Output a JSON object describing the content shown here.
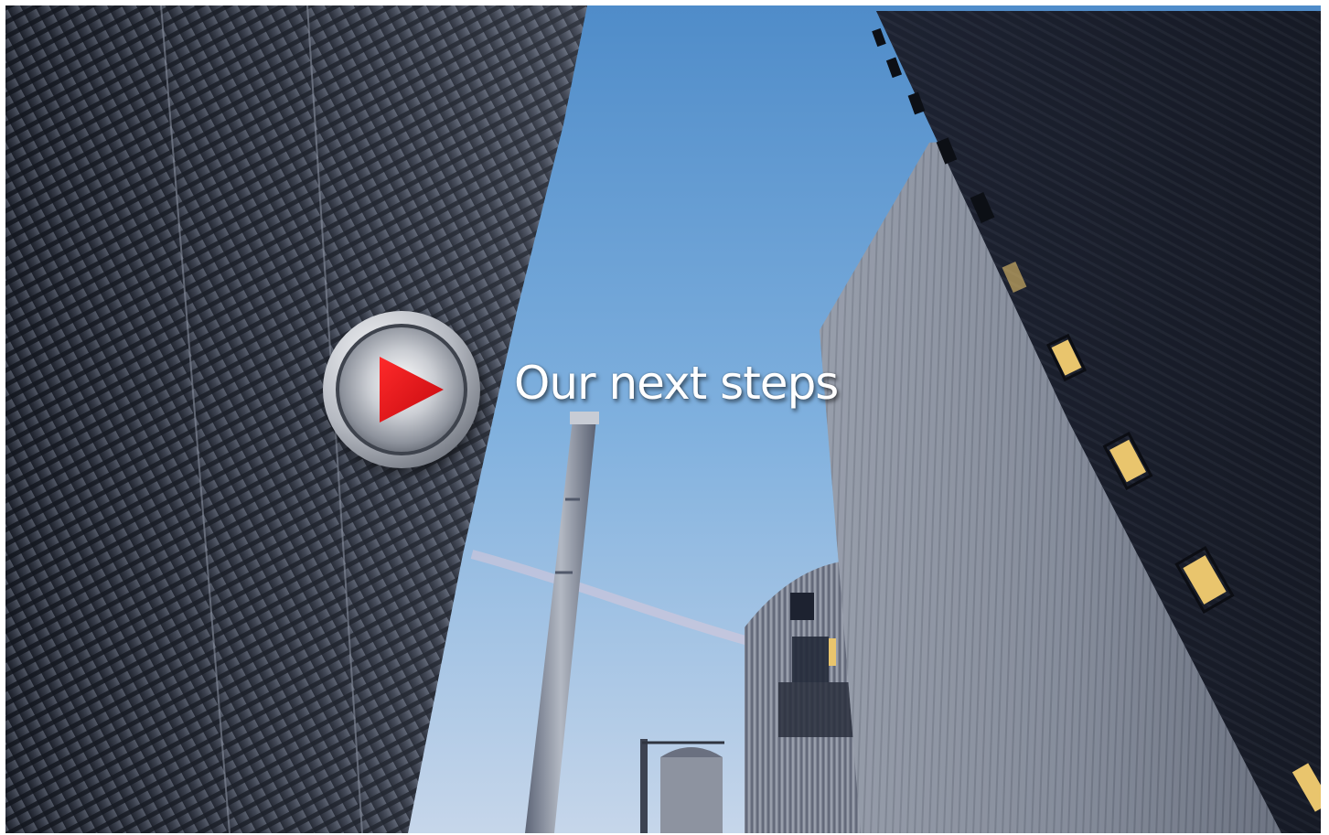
{
  "slide": {
    "title": "Our next steps"
  },
  "play_button": {
    "icon": "play-icon",
    "ring_color": "#b9bcc2",
    "triangle_color": "#e3141b"
  },
  "colors": {
    "sky_top": "#5f97cf",
    "sky_bottom": "#b9d3ea",
    "building_dark": "#1c2230",
    "building_silver": "#8f96a4",
    "window_light": "#e9c56d"
  }
}
